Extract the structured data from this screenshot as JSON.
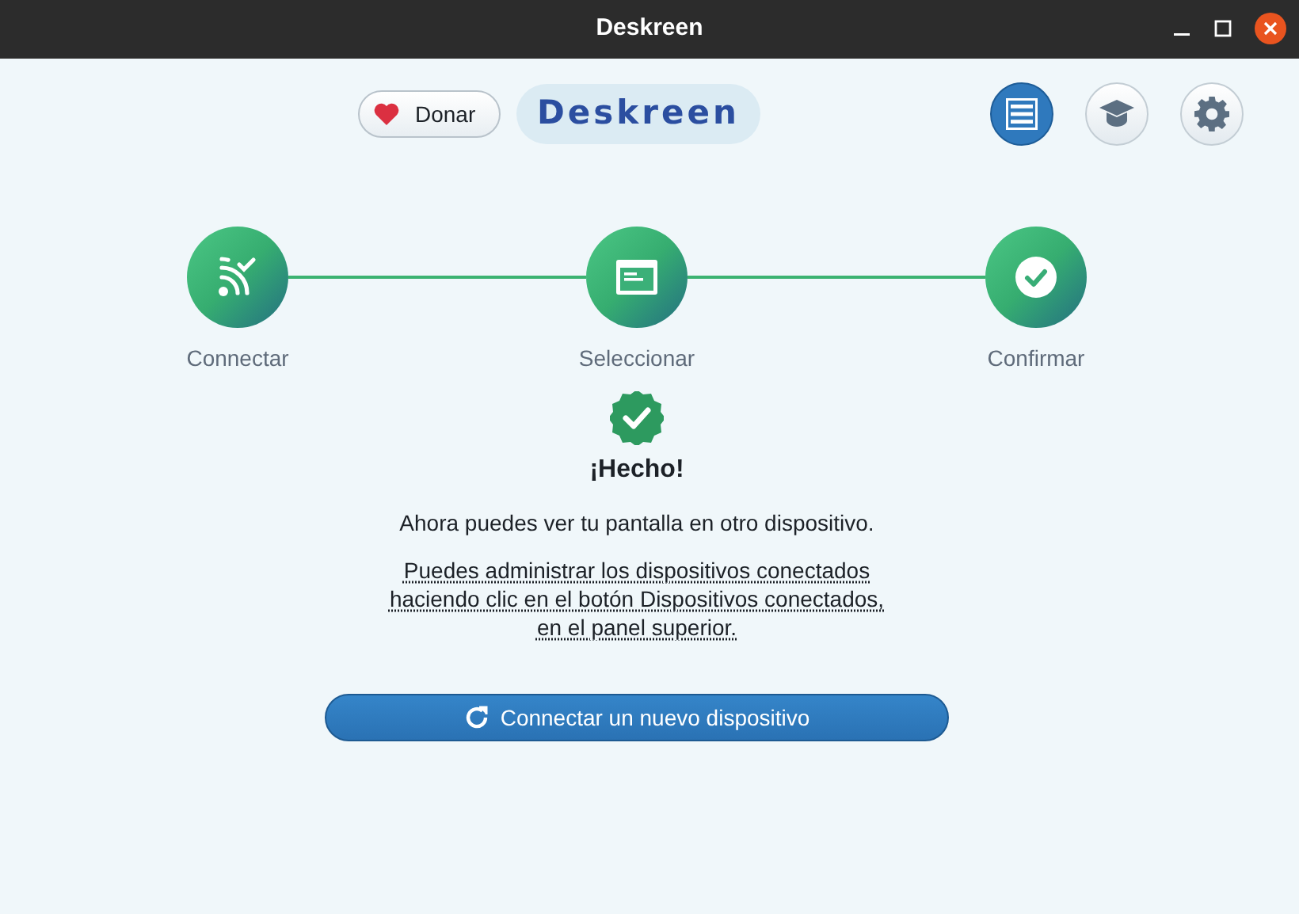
{
  "window": {
    "title": "Deskreen"
  },
  "header": {
    "donate": "Donar",
    "logo": "Deskreen",
    "tools": [
      {
        "kind": "devices",
        "selected": true
      },
      {
        "kind": "tutorial",
        "selected": false
      },
      {
        "kind": "settings",
        "selected": false
      }
    ]
  },
  "steps": [
    {
      "label": "Connectar",
      "kind": "connect",
      "completed": true
    },
    {
      "label": "Seleccionar",
      "kind": "select",
      "completed": true
    },
    {
      "label": "Confirmar",
      "kind": "confirm",
      "completed": true
    }
  ],
  "result": {
    "title": "¡Hecho!",
    "message": "Ahora puedes ver tu pantalla en otro dispositivo.",
    "hint": "Puedes administrar los dispositivos conectados haciendo clic en el botón Dispositivos conectados, en el panel superior.",
    "button": "Connectar un nuevo dispositivo"
  }
}
